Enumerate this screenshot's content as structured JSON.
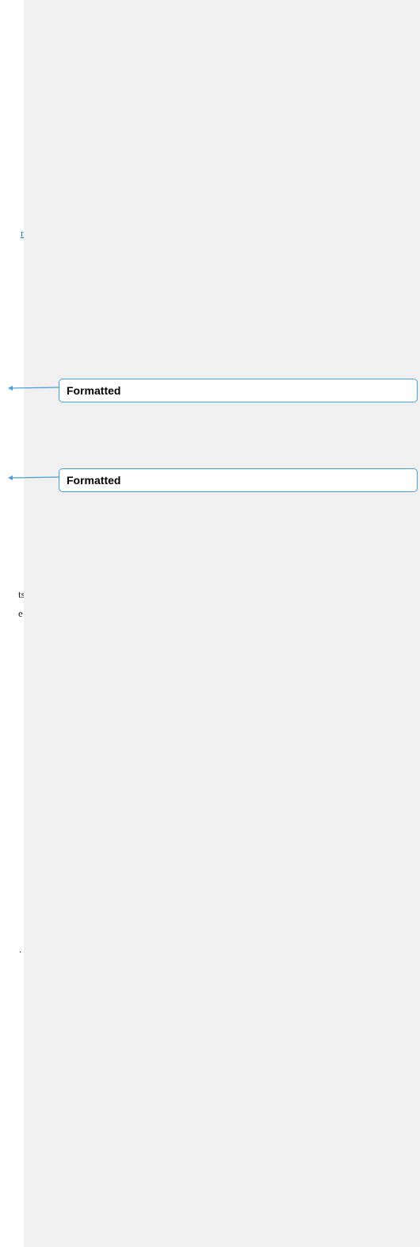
{
  "document": {
    "text_fragments": [
      "n",
      "",
      "ts",
      "e",
      "."
    ]
  },
  "markup": {
    "balloons": [
      {
        "label": "Formatted"
      },
      {
        "label": "Formatted"
      }
    ],
    "accent_color": "#4a9fd8",
    "pane_color": "#f0f0f0"
  }
}
